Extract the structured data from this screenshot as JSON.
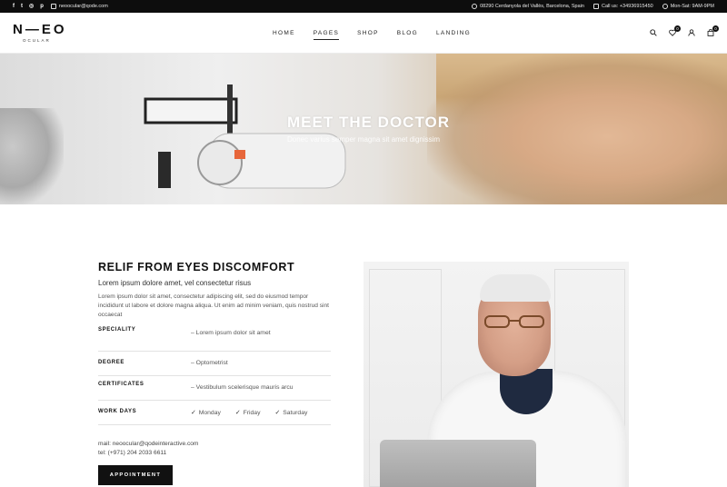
{
  "topbar": {
    "email": "neoocular@qode.com",
    "address": "08290 Cerdanyola del Vallès, Barcelona, Spain",
    "phone": "Call us: +34936915450",
    "hours": "Mon-Sat: 9AM-9PM",
    "social": [
      {
        "icon": "facebook-icon",
        "glyph": "f"
      },
      {
        "icon": "twitter-icon",
        "glyph": "t"
      },
      {
        "icon": "instagram-icon",
        "glyph": "◎"
      },
      {
        "icon": "pinterest-icon",
        "glyph": "p"
      }
    ]
  },
  "header": {
    "logo_main": "N—EO",
    "logo_sub": "OCULAR",
    "nav": [
      {
        "label": "HOME"
      },
      {
        "label": "PAGES",
        "active": true
      },
      {
        "label": "SHOP"
      },
      {
        "label": "BLOG"
      },
      {
        "label": "LANDING"
      }
    ],
    "wishlist_count": "0",
    "cart_count": "0"
  },
  "hero": {
    "title": "MEET THE DOCTOR",
    "subtitle": "Donec varius semper magna sit amet dignissim"
  },
  "main": {
    "title": "RELIF FROM EYES DISCOMFORT",
    "subtitle": "Lorem ipsum dolore amet, vel consectetur risus",
    "paragraph": "Lorem ipsum dolor sit amet, consectetur adipiscing elit, sed do eiusmod tempor incididunt ut labore et dolore magna aliqua. Ut enim ad minim veniam, quis nostrud sint occaecat",
    "rows": [
      {
        "label": "SPECIALITY",
        "value": "– Lorem ipsum dolor sit amet"
      },
      {
        "label": "DEGREE",
        "value": "– Optometrist"
      },
      {
        "label": "CERTIFICATES",
        "value": "– Vestibulum scelerisque mauris arcu"
      }
    ],
    "work_days_label": "WORK DAYS",
    "work_days": [
      "Monday",
      "Friday",
      "Saturday"
    ],
    "mail": "mail: neoocular@qodeinteractive.com",
    "tel": "tel: (+971) 204 2033 6611",
    "button_label": "APPOINTMENT"
  },
  "colors": {
    "topbar_bg": "#0d0d0d",
    "button_bg": "#111111",
    "text": "#222222"
  }
}
